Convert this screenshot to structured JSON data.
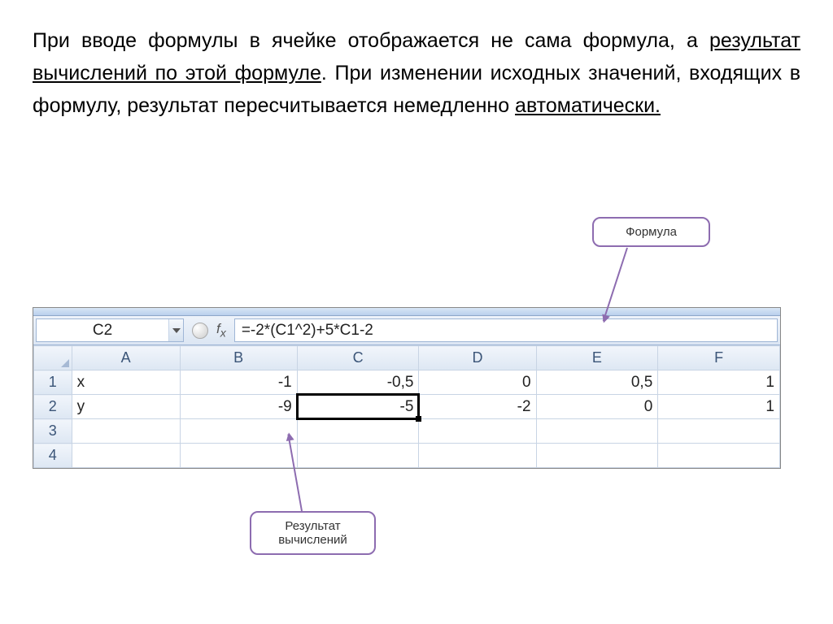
{
  "paragraph": {
    "p1a": "При вводе формулы в ячейке отображается не сама формула, а ",
    "p1u": "результат вычислений по этой формуле",
    "p1b": ". При изменении исходных значений, входящих в формулу, результат пересчитывается немедленно ",
    "p1c": "автоматически."
  },
  "callouts": {
    "formula": "Формула",
    "result_l1": "Результат",
    "result_l2": "вычислений"
  },
  "sheet": {
    "name_box": "C2",
    "formula_bar": "=-2*(C1^2)+5*C1-2",
    "col_headers": [
      "A",
      "B",
      "C",
      "D",
      "E",
      "F"
    ],
    "row_headers": [
      "1",
      "2",
      "3",
      "4"
    ],
    "rows": [
      {
        "A": "x",
        "B": "-1",
        "C": "-0,5",
        "D": "0",
        "E": "0,5",
        "F": "1"
      },
      {
        "A": "y",
        "B": "-9",
        "C": "-5",
        "D": "-2",
        "E": "0",
        "F": "1"
      },
      {
        "A": "",
        "B": "",
        "C": "",
        "D": "",
        "E": "",
        "F": ""
      },
      {
        "A": "",
        "B": "",
        "C": "",
        "D": "",
        "E": "",
        "F": ""
      }
    ]
  }
}
